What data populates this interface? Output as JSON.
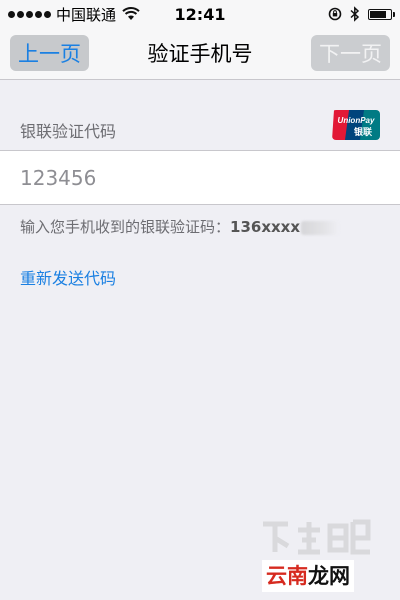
{
  "status_bar": {
    "carrier": "中国联通",
    "time": "12:41",
    "battery_level": 0.85
  },
  "nav": {
    "prev_label": "上一页",
    "title": "验证手机号",
    "next_label": "下一页"
  },
  "form": {
    "section_label": "银联验证代码",
    "code_value": "123456",
    "hint_text": "输入您手机收到的银联验证码：",
    "hint_phone": "136xxxx",
    "resend_label": "重新发送代码"
  },
  "logo": {
    "brand_text": "UnionPay",
    "brand_cn": "银联",
    "colors": [
      "#e21836",
      "#00447c",
      "#007b84"
    ]
  },
  "watermark": {
    "site_name_part1": "云南",
    "site_name_part2": "龙网"
  },
  "colors": {
    "accent": "#1b80e2",
    "background": "#efeff4",
    "bar": "#f7f7f8",
    "label_gray": "#6d6d72"
  }
}
